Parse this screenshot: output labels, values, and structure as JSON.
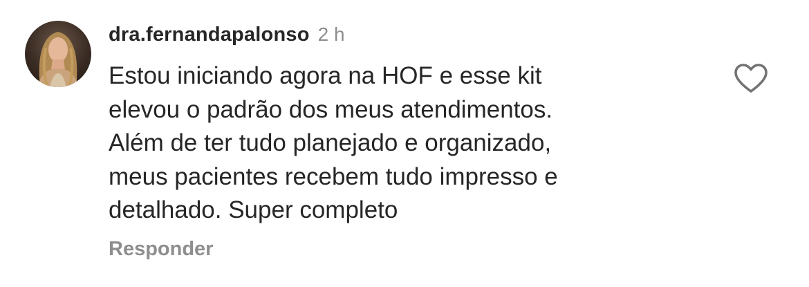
{
  "comment": {
    "username": "dra.fernandapalonso",
    "timestamp": "2 h",
    "text_lines": [
      "Estou iniciando agora na HOF e esse kit",
      "elevou o padrão dos meus atendimentos.",
      "Além de ter tudo planejado e organizado,",
      "meus pacientes recebem tudo impresso e",
      "detalhado. Super completo"
    ],
    "reply_label": "Responder",
    "like_icon": "heart-outline-icon"
  },
  "colors": {
    "text_primary": "#262626",
    "text_secondary": "#8e8e8e",
    "background": "#ffffff"
  }
}
